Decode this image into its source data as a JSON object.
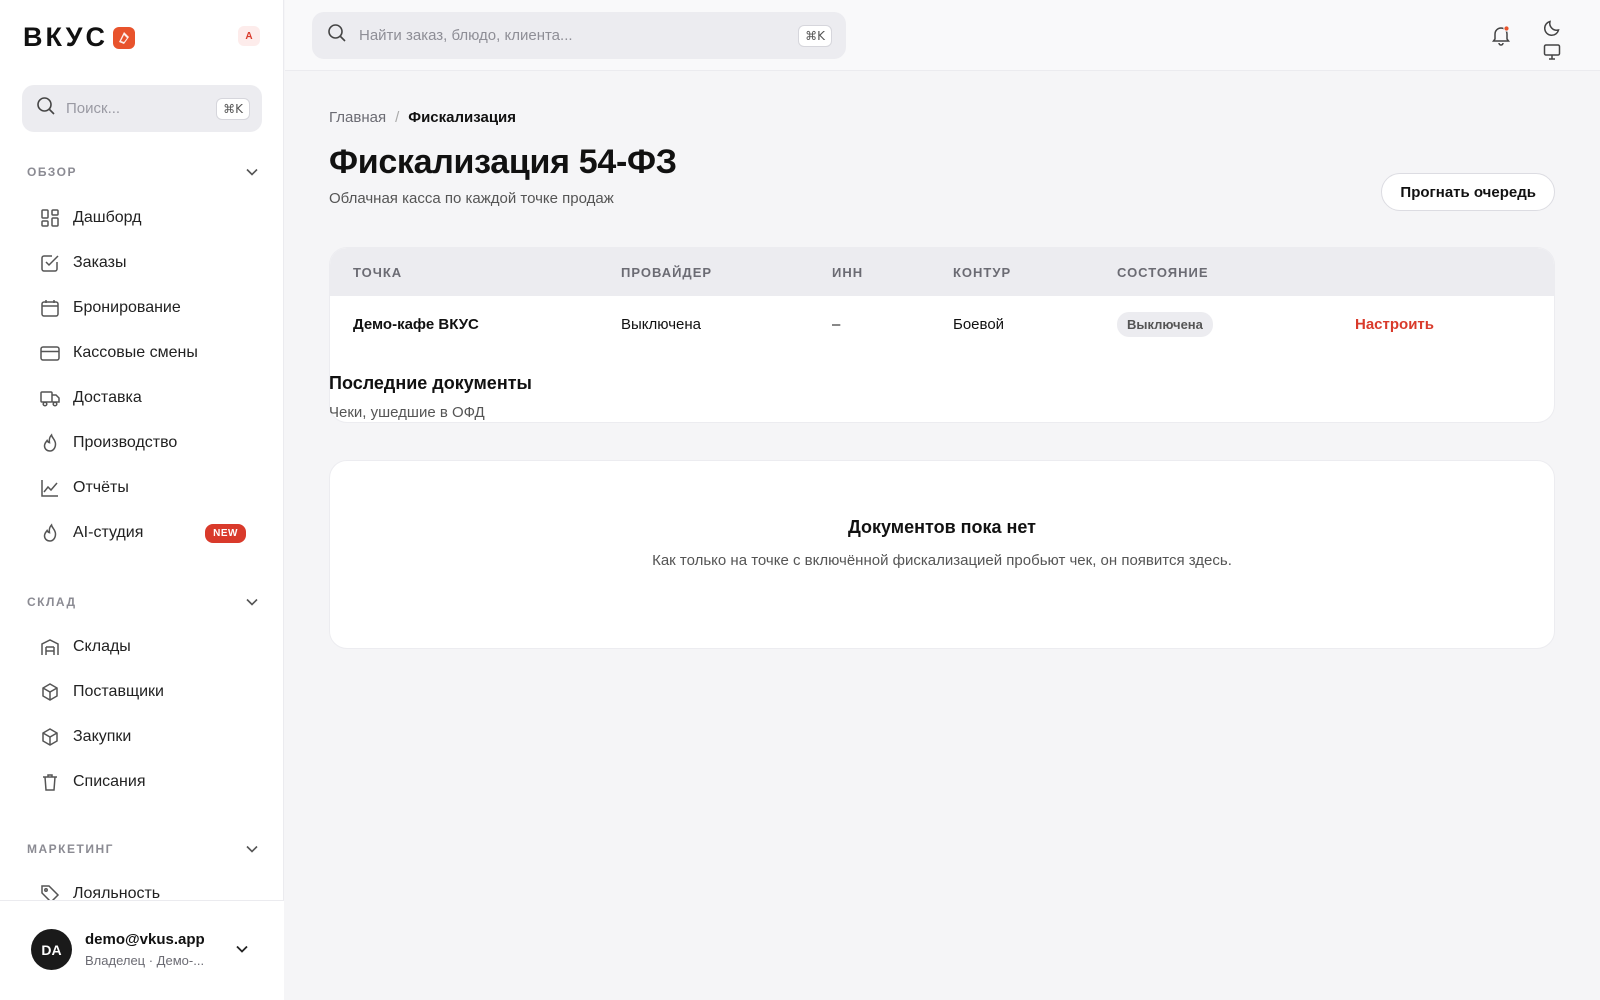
{
  "brand": {
    "name": "ВКУС",
    "lang": "A",
    "accent": "#e8532c"
  },
  "sidebar": {
    "search_placeholder": "Поиск...",
    "search_shortcut": "⌘K",
    "sections": {
      "overview": {
        "title": "ОБЗОР",
        "items": [
          {
            "label": "Дашборд",
            "icon": "dashboard-icon"
          },
          {
            "label": "Заказы",
            "icon": "orders-icon"
          },
          {
            "label": "Бронирование",
            "icon": "calendar-icon"
          },
          {
            "label": "Кассовые смены",
            "icon": "card-icon"
          },
          {
            "label": "Доставка",
            "icon": "truck-icon"
          },
          {
            "label": "Производство",
            "icon": "flame-icon"
          },
          {
            "label": "Отчёты",
            "icon": "chart-icon"
          },
          {
            "label": "AI-студия",
            "icon": "flame-icon",
            "badge": "NEW"
          }
        ]
      },
      "warehouse": {
        "title": "СКЛАД",
        "items": [
          {
            "label": "Склады",
            "icon": "warehouse-icon"
          },
          {
            "label": "Поставщики",
            "icon": "box-icon"
          },
          {
            "label": "Закупки",
            "icon": "box-icon"
          },
          {
            "label": "Списания",
            "icon": "trash-icon"
          }
        ]
      },
      "marketing": {
        "title": "МАРКЕТИНГ",
        "items": [
          {
            "label": "Лояльность",
            "icon": "tag-icon"
          }
        ]
      }
    },
    "user": {
      "initials": "DA",
      "email": "demo@vkus.app",
      "role": "Владелец · Демо-..."
    }
  },
  "topbar": {
    "search_placeholder": "Найти заказ, блюдо, клиента...",
    "search_shortcut": "⌘K"
  },
  "main": {
    "breadcrumb": {
      "home": "Главная",
      "separator": "/",
      "current": "Фискализация"
    },
    "title": "Фискализация 54-ФЗ",
    "subtitle": "Облачная касса по каждой точке продаж",
    "run_queue_label": "Прогнать очередь",
    "table": {
      "headers": [
        "ТОЧКА",
        "ПРОВАЙДЕР",
        "ИНН",
        "КОНТУР",
        "СОСТОЯНИЕ"
      ],
      "rows": [
        {
          "point": "Демо-кафе ВКУС",
          "provider": "Выключена",
          "inn": "–",
          "contour": "Боевой",
          "status": "Выключена",
          "action": "Настроить"
        }
      ]
    },
    "docs": {
      "title": "Последние документы",
      "subtitle": "Чеки, ушедшие в ОФД",
      "empty_title": "Документов пока нет",
      "empty_text": "Как только на точке с включённой фискализацией пробьют чек, он появится здесь."
    }
  }
}
